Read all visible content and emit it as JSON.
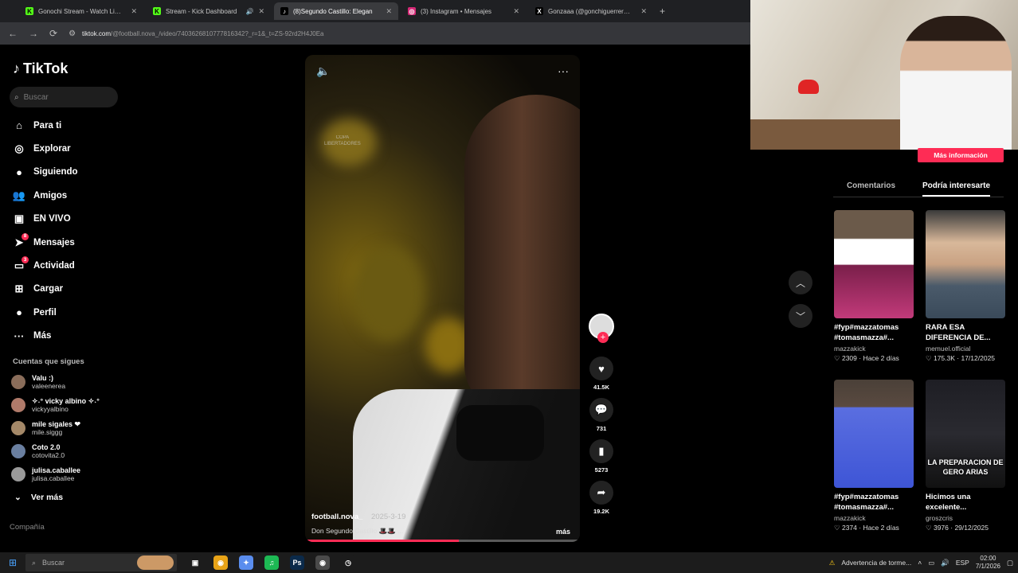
{
  "browser": {
    "tabs": [
      {
        "title": "Gonochi Stream - Watch Live o",
        "icon": "kick-icon",
        "color": "#53fc18",
        "glyph": "K",
        "extra": ""
      },
      {
        "title": "Stream - Kick Dashboard",
        "icon": "kick-icon",
        "color": "#53fc18",
        "glyph": "K",
        "extra": "🔊"
      },
      {
        "title": "(8)Segundo Castillo: Elegan",
        "icon": "tiktok-icon",
        "color": "#000000",
        "glyph": "♪",
        "extra": ""
      },
      {
        "title": "(3) Instagram • Mensajes",
        "icon": "instagram-icon",
        "color": "#d62976",
        "glyph": "◎",
        "extra": ""
      },
      {
        "title": "Gonzaaa (@gonchiguerrero_) /",
        "icon": "x-icon",
        "color": "#000000",
        "glyph": "X",
        "extra": ""
      }
    ],
    "url_host": "tiktok.com",
    "url_path": "/@football.nova_/video/7403626810777816342?_r=1&_t=ZS-92rd2H4J0Ea"
  },
  "sidebar": {
    "logo": "TikTok",
    "search_placeholder": "Buscar",
    "nav": [
      {
        "label": "Para ti",
        "icon": "home-icon",
        "glyph": "⌂",
        "badge": ""
      },
      {
        "label": "Explorar",
        "icon": "compass-icon",
        "glyph": "◎",
        "badge": ""
      },
      {
        "label": "Siguiendo",
        "icon": "following-icon",
        "glyph": "●",
        "badge": ""
      },
      {
        "label": "Amigos",
        "icon": "friends-icon",
        "glyph": "👥",
        "badge": ""
      },
      {
        "label": "EN VIVO",
        "icon": "live-icon",
        "glyph": "▣",
        "badge": ""
      },
      {
        "label": "Mensajes",
        "icon": "messages-icon",
        "glyph": "➤",
        "badge": "8"
      },
      {
        "label": "Actividad",
        "icon": "activity-icon",
        "glyph": "▭",
        "badge": "3"
      },
      {
        "label": "Cargar",
        "icon": "upload-icon",
        "glyph": "⊞",
        "badge": ""
      },
      {
        "label": "Perfil",
        "icon": "profile-icon",
        "glyph": "●",
        "badge": ""
      },
      {
        "label": "Más",
        "icon": "more-icon",
        "glyph": "···",
        "badge": ""
      }
    ],
    "following_title": "Cuentas que sigues",
    "following": [
      {
        "name": "Valu :)",
        "handle": "valeenerea",
        "color": "#8a6d5a"
      },
      {
        "name": "✧˖° vicky albino ✧˖°",
        "handle": "vickyyalbino",
        "color": "#b07a6a"
      },
      {
        "name": "mile sigales ❤",
        "handle": "mile.siggg",
        "color": "#a48868"
      },
      {
        "name": "Coto 2.0",
        "handle": "cotovita2.0",
        "color": "#6a7fa0"
      },
      {
        "name": "julisa.caballee",
        "handle": "julisa.caballee",
        "color": "#9a9a9a"
      }
    ],
    "see_more": "Ver más",
    "company": "Compañía"
  },
  "video": {
    "author": "football.nova_",
    "date": "2025-3-19",
    "description": "Don Segundo Castillo 🎩🎩 ...",
    "more": "más",
    "progress": 0.56,
    "watermark_line1": "COPA",
    "watermark_line2": "LIBERTADORES"
  },
  "actions": {
    "likes": "41.5K",
    "comments": "731",
    "saves": "5273",
    "shares": "19.2K"
  },
  "right_panel": {
    "more_info": "Más información",
    "tabs": [
      "Comentarios",
      "Podría interesarte"
    ],
    "active_tab": 1,
    "cards": [
      {
        "title": "#fyp#mazzatomas #tomasmazza#...",
        "author": "mazzakick",
        "stats": "♡ 2309 · Hace 2 días",
        "overlay": ""
      },
      {
        "title": "RARA ESA DIFERENCIA DE...",
        "author": "memuel.official",
        "stats": "♡ 175.3K · 17/12/2025",
        "overlay": ""
      },
      {
        "title": "#fyp#mazzatomas #tomasmazza#...",
        "author": "mazzakick",
        "stats": "♡ 2374 · Hace 2 días",
        "overlay": ""
      },
      {
        "title": "Hicimos una excelente...",
        "author": "groszcris",
        "stats": "♡ 3976 · 29/12/2025",
        "overlay": "LA PREPARACION DE GERO ARIAS"
      }
    ]
  },
  "taskbar": {
    "search_placeholder": "Buscar",
    "apps": [
      {
        "icon": "task-view-icon",
        "glyph": "▣",
        "color": "#1c1c1c"
      },
      {
        "icon": "chrome-icon",
        "glyph": "◉",
        "color": "#e8a317"
      },
      {
        "icon": "copilot-icon",
        "glyph": "✦",
        "color": "#5a8dee"
      },
      {
        "icon": "spotify-icon",
        "glyph": "♫",
        "color": "#1db954"
      },
      {
        "icon": "photoshop-icon",
        "glyph": "Ps",
        "color": "#0b2a4a"
      },
      {
        "icon": "chrome-active-icon",
        "glyph": "◉",
        "color": "#4a4a4a"
      },
      {
        "icon": "clock-app-icon",
        "glyph": "◷",
        "color": "#1c1c1c"
      }
    ],
    "notice": "Advertencia de torme...",
    "lang": "ESP",
    "time": "02:00",
    "date": "7/1/2026"
  }
}
